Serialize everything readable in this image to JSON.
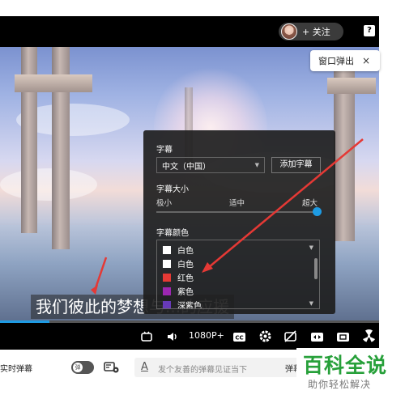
{
  "header": {
    "follow_label": "+ 关注",
    "help_icon": "?",
    "popout_label": "窗口弹出",
    "popout_close": "×"
  },
  "video": {
    "subtitle_text": "我们彼此的梦想与...的应援",
    "progress_fraction": 0.13
  },
  "subtitle_panel": {
    "title": "字幕",
    "language_value": "中文（中国）",
    "add_button": "添加字幕",
    "size_title": "字幕大小",
    "size_labels": [
      "极小",
      "适中",
      "超大"
    ],
    "size_value": "超大",
    "color_title": "字幕颜色",
    "colors": [
      {
        "label": "白色",
        "swatch": "#ffffff"
      },
      {
        "label": "白色",
        "swatch": "#ffffff"
      },
      {
        "label": "红色",
        "swatch": "#e53935"
      },
      {
        "label": "紫色",
        "swatch": "#9c27b0"
      },
      {
        "label": "深紫色",
        "swatch": "#673ab7"
      }
    ]
  },
  "controls": {
    "quality": "1080P+",
    "icons": [
      "tv-icon",
      "volume-icon",
      "cc-icon",
      "settings-icon",
      "no-danmaku-icon",
      "widescreen-icon",
      "fullscreen-icon",
      "radiation-icon"
    ]
  },
  "bottom_bar": {
    "realtime_danmaku": "实时弹幕",
    "toggle_label": "弹",
    "input_placeholder": "发个友善的弹幕见证当下",
    "input_icon_letter": "A",
    "send_partial": "弹幕"
  },
  "watermark": {
    "title": "百科全说",
    "subtitle": "助你轻松解决"
  },
  "colors": {
    "accent": "#1e9be3",
    "arrow": "#e53935",
    "watermark_green": "#27a03a"
  }
}
